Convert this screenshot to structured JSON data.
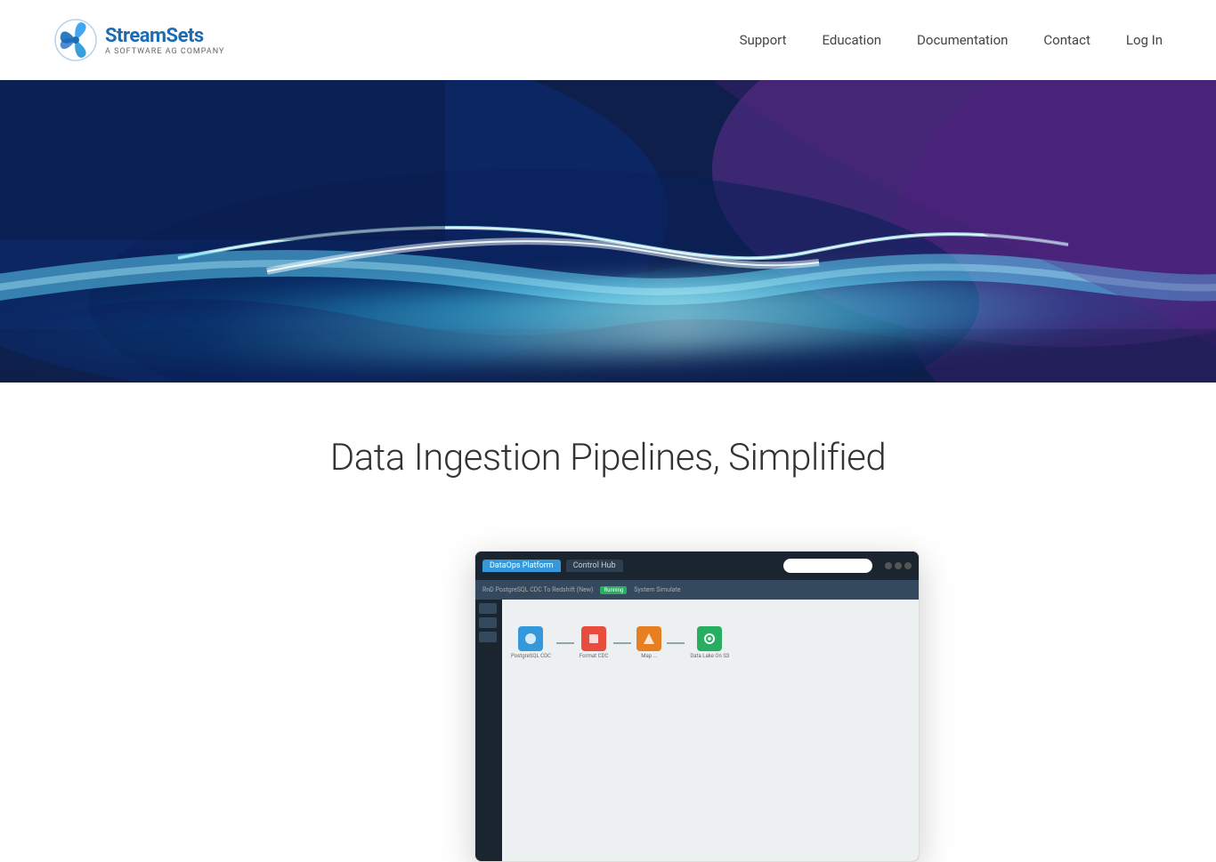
{
  "header": {
    "logo": {
      "brand": "StreamSets",
      "tagline": "A SOFTWARE AG COMPANY"
    },
    "nav": {
      "items": [
        {
          "label": "Support",
          "id": "support"
        },
        {
          "label": "Education",
          "id": "education"
        },
        {
          "label": "Documentation",
          "id": "documentation"
        },
        {
          "label": "Contact",
          "id": "contact"
        },
        {
          "label": "Log In",
          "id": "login"
        }
      ]
    }
  },
  "hero": {
    "alt": "Abstract blue and purple wave background"
  },
  "main": {
    "headline": "Data Ingestion Pipelines, Simplified"
  },
  "screenshot": {
    "alt": "StreamSets DataOps Platform Control Hub screenshot",
    "pipeline": {
      "source_label": "PostgreSQL CDC",
      "transform_label": "Format CDC",
      "map_label": "Map ...",
      "dest_label": "Data Lake On S3"
    }
  }
}
